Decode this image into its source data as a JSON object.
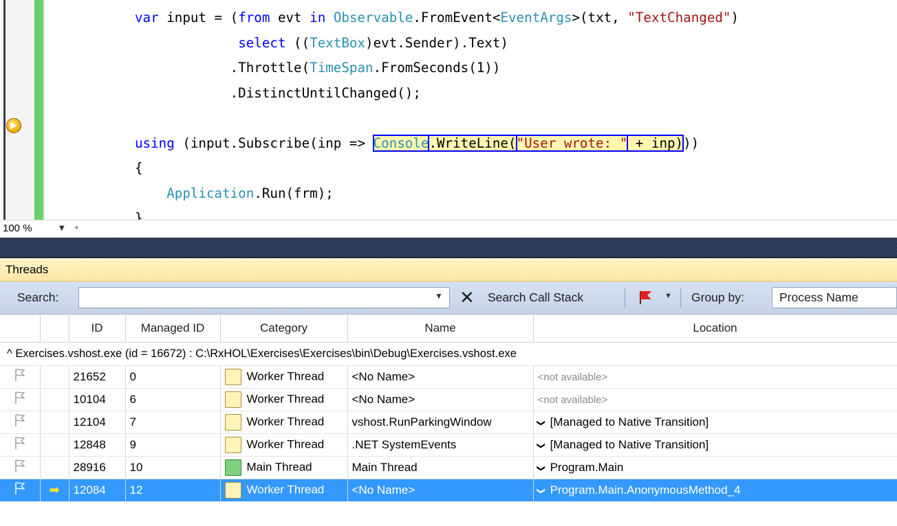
{
  "editor": {
    "lines": [
      {
        "segments": [
          {
            "t": "var ",
            "c": "kw"
          },
          {
            "t": "input = ("
          },
          {
            "t": "from",
            "c": "kw"
          },
          {
            "t": " evt "
          },
          {
            "t": "in",
            "c": "kw"
          },
          {
            "t": " "
          },
          {
            "t": "Observable",
            "c": "ty"
          },
          {
            "t": ".FromEvent<"
          },
          {
            "t": "EventArgs",
            "c": "ty"
          },
          {
            "t": ">(txt, "
          },
          {
            "t": "\"TextChanged\"",
            "c": "str"
          },
          {
            "t": ")"
          }
        ]
      },
      {
        "segments": [
          {
            "t": "             "
          },
          {
            "t": "select",
            "c": "kw"
          },
          {
            "t": " (("
          },
          {
            "t": "TextBox",
            "c": "ty"
          },
          {
            "t": ")evt.Sender).Text)"
          }
        ]
      },
      {
        "segments": [
          {
            "t": "            .Throttle("
          },
          {
            "t": "TimeSpan",
            "c": "ty"
          },
          {
            "t": ".FromSeconds(1))"
          }
        ]
      },
      {
        "segments": [
          {
            "t": "            .DistinctUntilChanged();"
          }
        ]
      },
      {
        "segments": [
          {
            "t": ""
          }
        ]
      },
      {
        "segments": [
          {
            "t": "using",
            "c": "kw"
          },
          {
            "t": " (input.Subscribe(inp => "
          },
          {
            "t": "Console",
            "c": "ty hl"
          },
          {
            "t": ".WriteLine(",
            "c": "hl"
          },
          {
            "t": "\"User wrote: \"",
            "c": "str hl"
          },
          {
            "t": " + inp)",
            "c": "hl"
          },
          {
            "t": "))"
          }
        ]
      },
      {
        "segments": [
          {
            "t": "{"
          }
        ]
      },
      {
        "segments": [
          {
            "t": "    "
          },
          {
            "t": "Application",
            "c": "ty"
          },
          {
            "t": ".Run(frm);"
          }
        ]
      },
      {
        "segments": [
          {
            "t": "}"
          }
        ]
      }
    ]
  },
  "zoom": {
    "value": "100 %"
  },
  "threads": {
    "title": "Threads",
    "toolbar": {
      "search_label": "Search:",
      "search_value": "",
      "search_call_stack": "Search Call Stack",
      "group_by_label": "Group by:",
      "group_by_value": "Process Name"
    },
    "columns": [
      "",
      "",
      "ID",
      "Managed ID",
      "Category",
      "Name",
      "Location"
    ],
    "group": "Exercises.vshost.exe (id = 16672) : C:\\RxHOL\\Exercises\\Exercises\\bin\\Debug\\Exercises.vshost.exe",
    "rows": [
      {
        "id": "21652",
        "managed_id": "0",
        "category": "Worker Thread",
        "cat_kind": "worker",
        "name": "<No Name>",
        "location": "<not available>",
        "loc_na": true,
        "selected": false,
        "current": false
      },
      {
        "id": "10104",
        "managed_id": "6",
        "category": "Worker Thread",
        "cat_kind": "worker",
        "name": "<No Name>",
        "location": "<not available>",
        "loc_na": true,
        "selected": false,
        "current": false
      },
      {
        "id": "12104",
        "managed_id": "7",
        "category": "Worker Thread",
        "cat_kind": "worker",
        "name": "vshost.RunParkingWindow",
        "location": "[Managed to Native Transition]",
        "loc_na": false,
        "selected": false,
        "current": false
      },
      {
        "id": "12848",
        "managed_id": "9",
        "category": "Worker Thread",
        "cat_kind": "worker",
        "name": ".NET SystemEvents",
        "location": "[Managed to Native Transition]",
        "loc_na": false,
        "selected": false,
        "current": false
      },
      {
        "id": "28916",
        "managed_id": "10",
        "category": "Main Thread",
        "cat_kind": "main",
        "name": "Main Thread",
        "location": "Program.Main",
        "loc_na": false,
        "selected": false,
        "current": false
      },
      {
        "id": "12084",
        "managed_id": "12",
        "category": "Worker Thread",
        "cat_kind": "worker",
        "name": "<No Name>",
        "location": "Program.Main.AnonymousMethod_4",
        "loc_na": false,
        "selected": true,
        "current": true
      }
    ]
  }
}
